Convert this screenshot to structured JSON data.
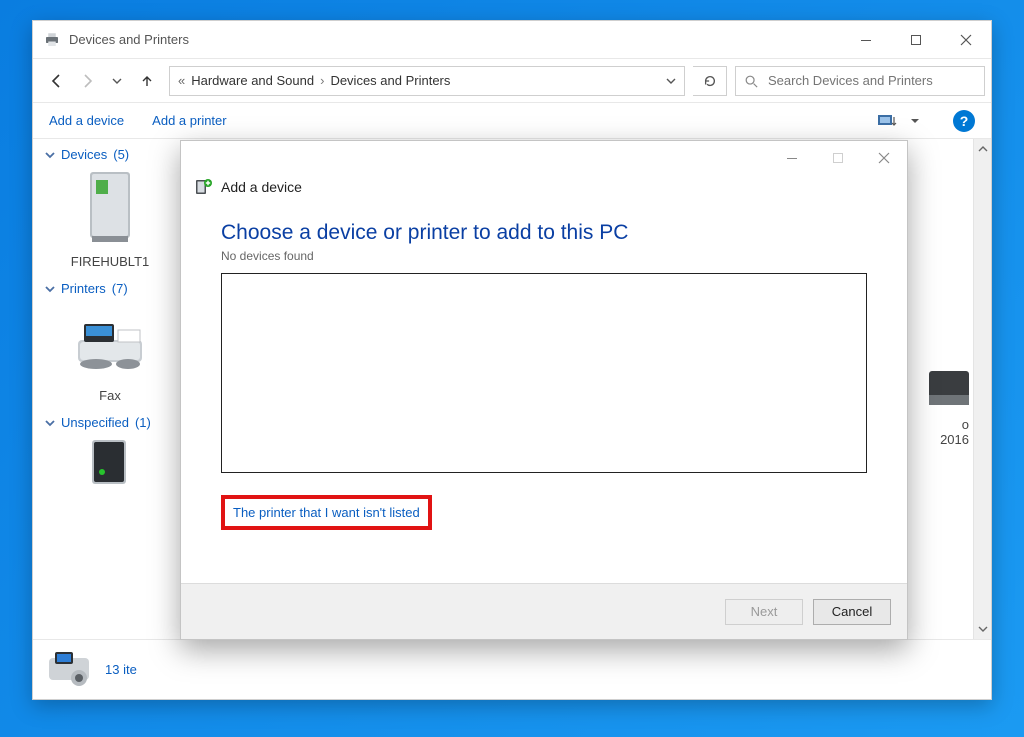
{
  "window": {
    "title": "Devices and Printers",
    "breadcrumbs": {
      "item0": "Hardware and Sound",
      "item1": "Devices and Printers"
    },
    "search_placeholder": "Search Devices and Printers",
    "toolbar": {
      "add_device": "Add a device",
      "add_printer": "Add a printer"
    },
    "groups": {
      "devices": {
        "label": "Devices",
        "count": "(5)"
      },
      "printers": {
        "label": "Printers",
        "count": "(7)"
      },
      "unspecified": {
        "label": "Unspecified",
        "count": "(1)"
      }
    },
    "items": {
      "device0": "FIREHUBLT1",
      "printer0": "Fax",
      "printer_right_a": "o",
      "printer_right_b": "2016"
    },
    "status": "13 ite"
  },
  "wizard": {
    "window_title": "Add a device",
    "heading": "Choose a device or printer to add to this PC",
    "subtext": "No devices found",
    "link_text": "The printer that I want isn't listed",
    "next": "Next",
    "cancel": "Cancel"
  }
}
